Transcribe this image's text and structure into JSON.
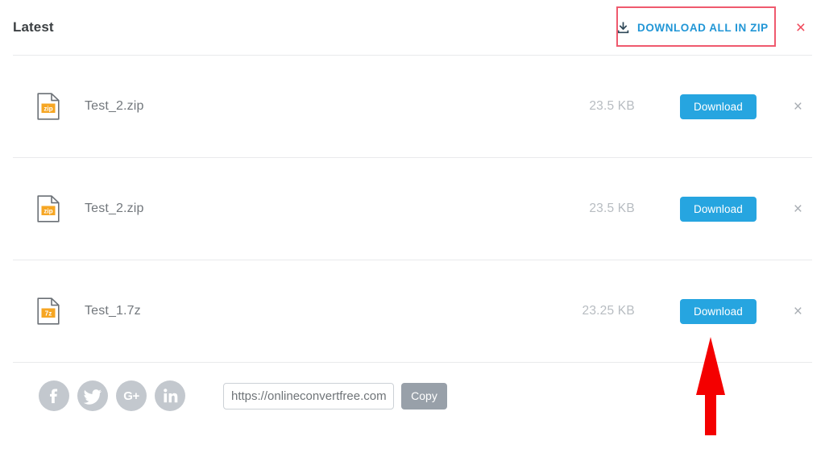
{
  "header": {
    "title": "Latest",
    "download_all_label": "DOWNLOAD ALL IN ZIP",
    "download_all_icon": "download-icon",
    "close_label": "×"
  },
  "colors": {
    "accent_blue": "#26a5e0",
    "link_blue": "#2196d6",
    "annotation_red": "#ef5a6e",
    "arrow_red": "#f40000",
    "zip_badge_orange": "#f6a623",
    "divider_gray": "#e9eaec",
    "file_size_gray": "#b7bcc1",
    "social_gray": "#c3c8ce",
    "copy_button_gray": "#98a0a9"
  },
  "files": [
    {
      "name": "Test_2.zip",
      "size": "23.5 KB",
      "ext_badge": "zip",
      "icon": "zip-file-icon",
      "download_label": "Download",
      "close_label": "×"
    },
    {
      "name": "Test_2.zip",
      "size": "23.5 KB",
      "ext_badge": "zip",
      "icon": "zip-file-icon",
      "download_label": "Download",
      "close_label": "×"
    },
    {
      "name": "Test_1.7z",
      "size": "23.25 KB",
      "ext_badge": "7z",
      "icon": "sevenzip-file-icon",
      "download_label": "Download",
      "close_label": "×"
    }
  ],
  "share": {
    "social": [
      {
        "name": "facebook-icon",
        "glyph": "f"
      },
      {
        "name": "twitter-icon",
        "glyph": "t"
      },
      {
        "name": "google-plus-icon",
        "glyph": "G+"
      },
      {
        "name": "linkedin-icon",
        "glyph": "in"
      }
    ],
    "url_value": "https://onlineconvertfree.com",
    "url_placeholder": "https://onlineconvertfree.com",
    "copy_label": "Copy"
  },
  "annotations": {
    "highlight_box": "download-all-in-zip",
    "arrow_points_to": "download-button-row-3"
  }
}
